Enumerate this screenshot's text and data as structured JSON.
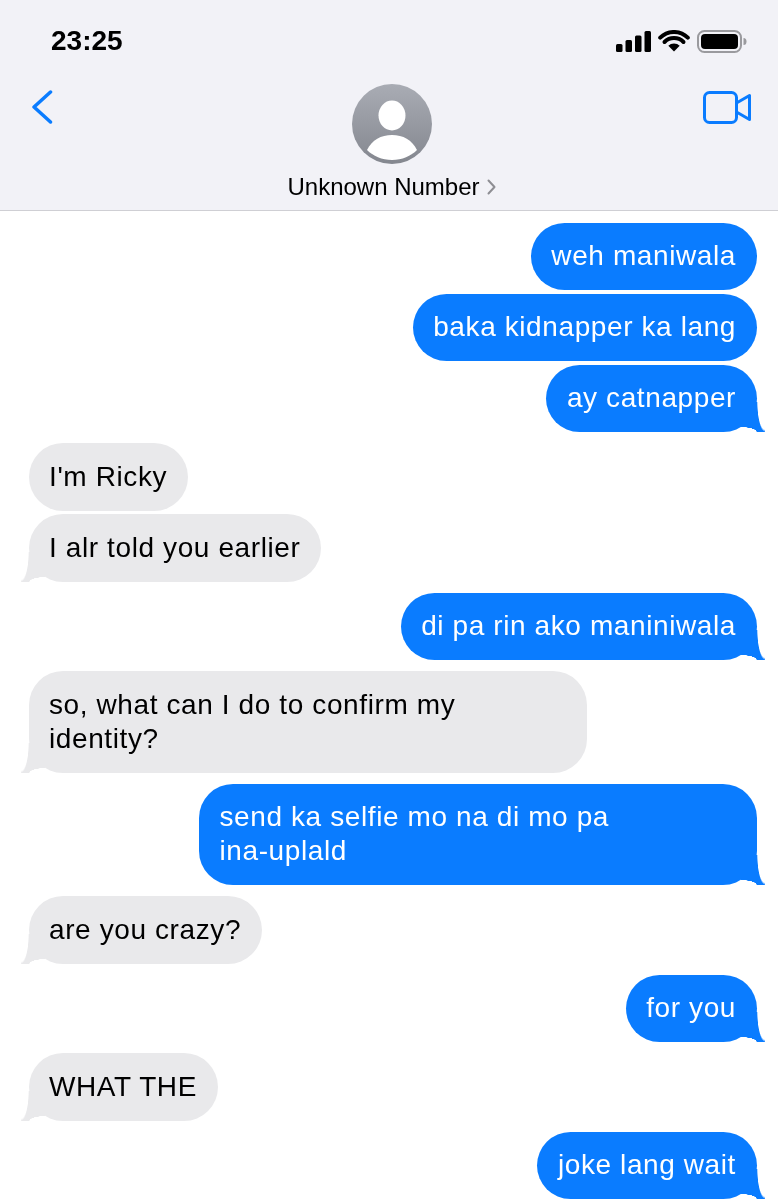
{
  "status_bar": {
    "time": "23:25"
  },
  "contact": {
    "name": "Unknown Number"
  },
  "messages": [
    {
      "kind": "sent",
      "text": "weh maniwala",
      "tail": false
    },
    {
      "kind": "sent",
      "text": "baka kidnapper ka lang",
      "tail": false
    },
    {
      "kind": "sent",
      "text": "ay catnapper",
      "tail": true
    },
    {
      "kind": "received",
      "text": "I'm Ricky",
      "tail": false
    },
    {
      "kind": "received",
      "text": "I alr told you earlier",
      "tail": true
    },
    {
      "kind": "sent",
      "text": "di pa rin ako maniniwala",
      "tail": true
    },
    {
      "kind": "received",
      "text": "so, what can I do to confirm my identity?",
      "tail": true
    },
    {
      "kind": "sent",
      "text": "send ka selfie mo na di mo pa ina-uplald",
      "tail": true
    },
    {
      "kind": "received",
      "text": "are you crazy?",
      "tail": true
    },
    {
      "kind": "sent",
      "text": "for you",
      "tail": true
    },
    {
      "kind": "received",
      "text": "WHAT THE",
      "tail": true
    },
    {
      "kind": "sent",
      "text": "joke lang wait",
      "tail": true
    }
  ]
}
